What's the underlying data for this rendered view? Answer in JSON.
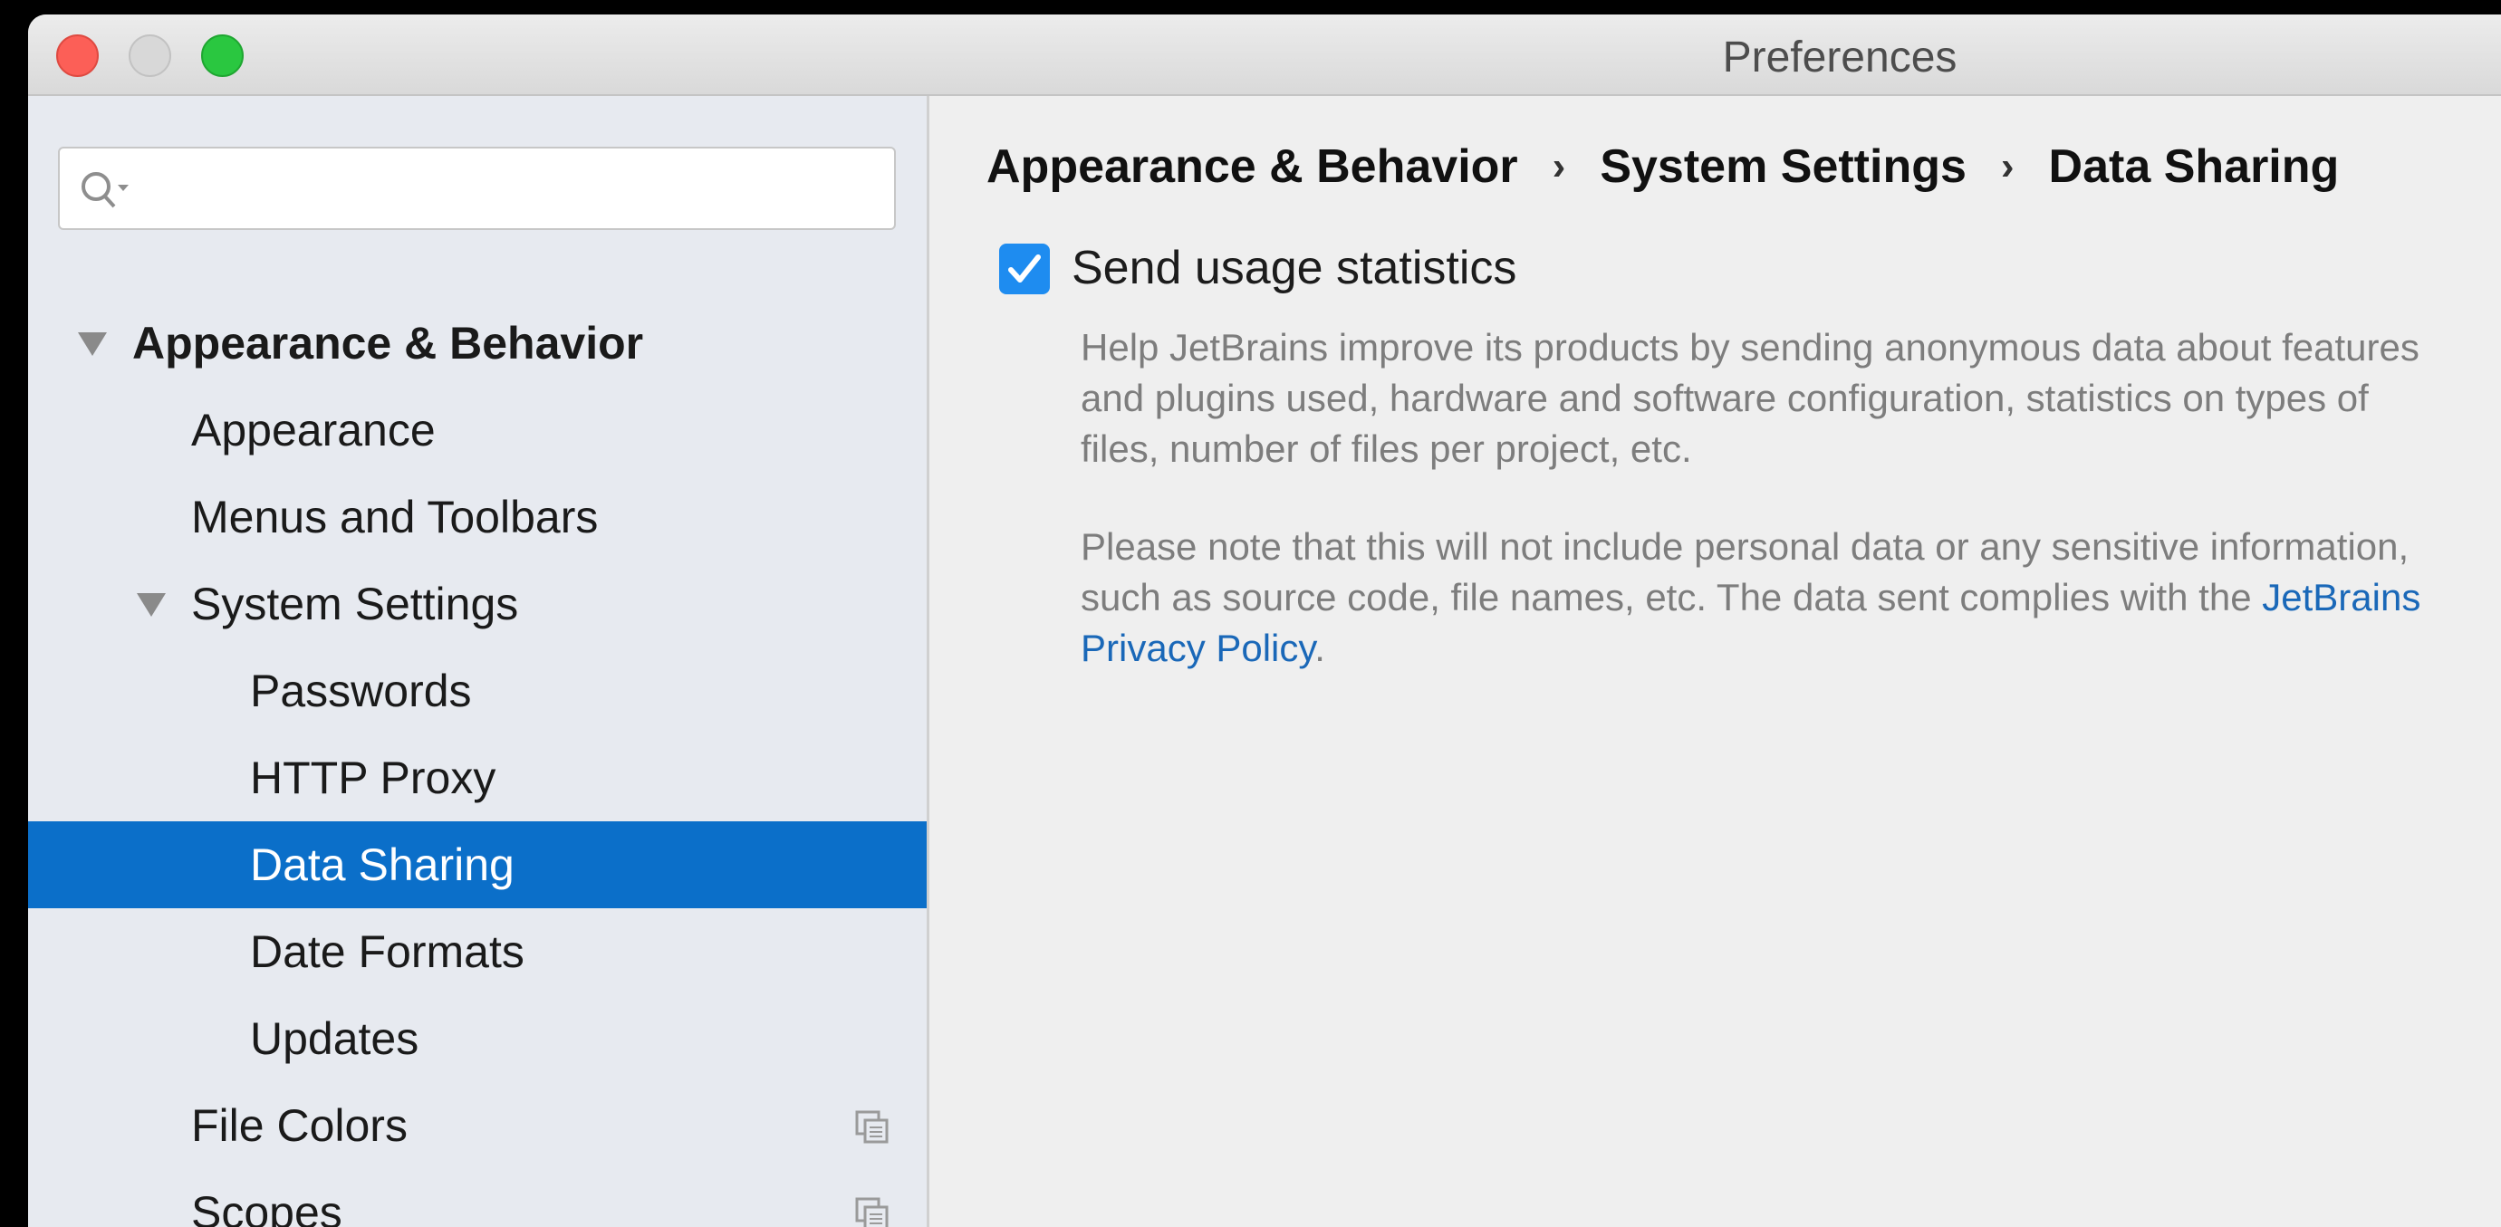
{
  "window": {
    "title": "Preferences"
  },
  "search": {
    "placeholder": ""
  },
  "sidebar": {
    "items": [
      {
        "label": "Appearance & Behavior"
      },
      {
        "label": "Appearance"
      },
      {
        "label": "Menus and Toolbars"
      },
      {
        "label": "System Settings"
      },
      {
        "label": "Passwords"
      },
      {
        "label": "HTTP Proxy"
      },
      {
        "label": "Data Sharing"
      },
      {
        "label": "Date Formats"
      },
      {
        "label": "Updates"
      },
      {
        "label": "File Colors"
      },
      {
        "label": "Scopes"
      }
    ]
  },
  "breadcrumb": [
    "Appearance & Behavior",
    "System Settings",
    "Data Sharing"
  ],
  "breadcrumb_separator": "›",
  "settings": {
    "send_usage": {
      "label": "Send usage statistics",
      "checked": true
    },
    "help_text_1": "Help JetBrains improve its products by sending anonymous data about features and plugins used, hardware and software configuration, statistics on types of files, number of files per project, etc.",
    "help_text_2_prefix": "Please note that this will not include personal data or any sensitive information, such as source code, file names, etc. The data sent complies with the ",
    "privacy_link": "JetBrains Privacy Policy",
    "help_text_2_suffix": "."
  },
  "colors": {
    "accent": "#0b6fc9",
    "checkbox": "#1e8cf0",
    "link": "#1a68b8"
  }
}
